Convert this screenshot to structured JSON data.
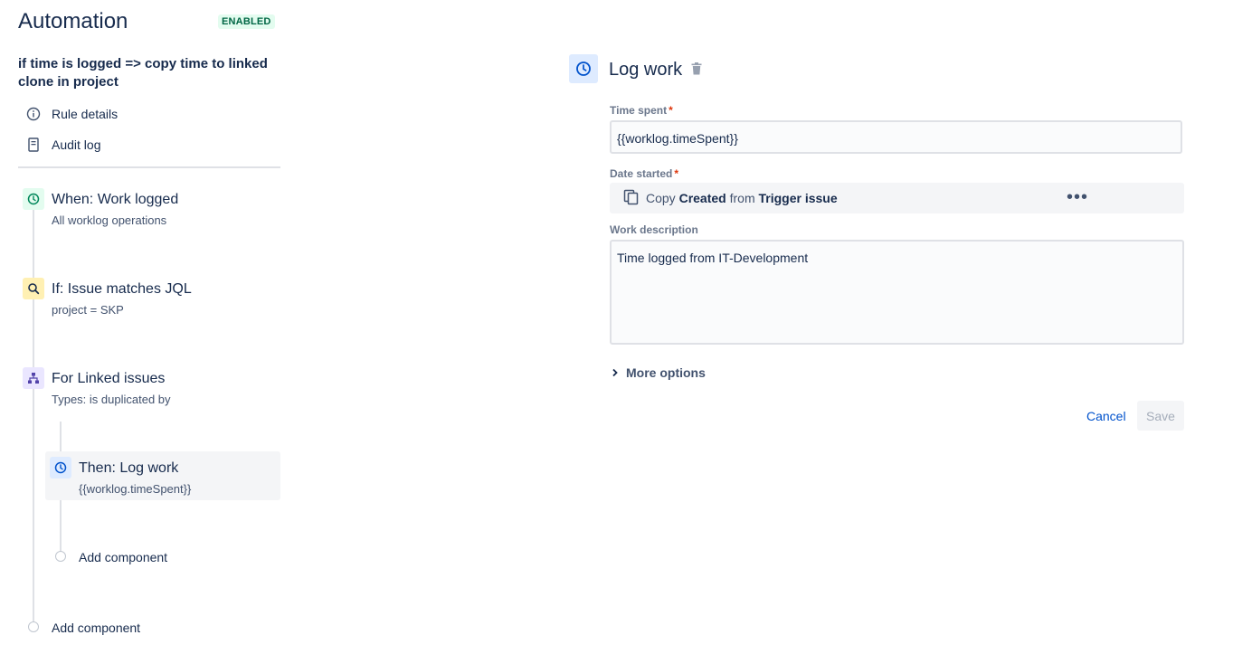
{
  "app": {
    "title": "Automation",
    "status_badge": "ENABLED"
  },
  "rule": {
    "name": "if time is logged => copy time to linked clone in project"
  },
  "nav": [
    {
      "label": "Rule details",
      "icon": "info-icon"
    },
    {
      "label": "Audit log",
      "icon": "document-icon"
    }
  ],
  "components": {
    "trigger": {
      "title": "When: Work logged",
      "subtitle": "All worklog operations",
      "icon": "clock-icon",
      "color": "#e3fcef"
    },
    "condition": {
      "title": "If: Issue matches JQL",
      "subtitle": "project = SKP",
      "icon": "search-icon",
      "color": "#fff0b3"
    },
    "branch": {
      "title": "For Linked issues",
      "subtitle": "Types: is duplicated by",
      "icon": "hierarchy-icon",
      "color": "#eae6ff"
    },
    "action": {
      "title": "Then: Log work",
      "subtitle": "{{worklog.timeSpent}}",
      "icon": "clock-icon",
      "color": "#deebff"
    },
    "add_inner": "Add component",
    "add_outer": "Add component"
  },
  "editor": {
    "title": "Log work",
    "time_spent": {
      "label": "Time spent",
      "required_mark": "*",
      "value": "{{worklog.timeSpent}}"
    },
    "date_started": {
      "label": "Date started",
      "required_mark": "*",
      "copy_word": "Copy",
      "field": "Created",
      "from_word": "from",
      "source": "Trigger issue",
      "more_icon": "•••"
    },
    "work_description": {
      "label": "Work description",
      "value": "Time logged from IT-Development"
    },
    "more_options": "More options",
    "cancel_label": "Cancel",
    "save_label": "Save"
  },
  "colors": {
    "accent": "#0052cc",
    "text": "#172b4d",
    "required": "#de350b"
  }
}
